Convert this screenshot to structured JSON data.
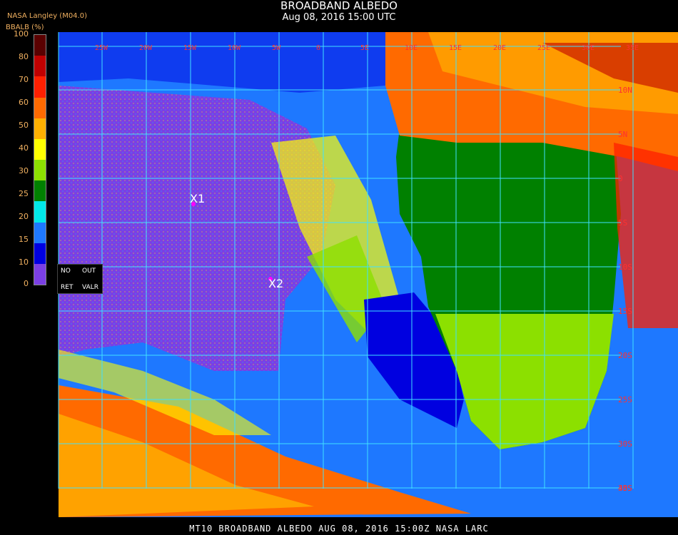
{
  "header": {
    "title": "BROADBAND ALBEDO",
    "subtitle": "Aug 08, 2016 15:00 UTC",
    "producer": "NASA Langley (M04.0)"
  },
  "legend": {
    "title": "BBALB (%)",
    "ticks": [
      "100",
      "80",
      "70",
      "60",
      "50",
      "40",
      "30",
      "25",
      "20",
      "15",
      "10",
      "0"
    ],
    "colors": [
      "#5a0000",
      "#c00000",
      "#ff2000",
      "#ff6a00",
      "#ffb000",
      "#ffff00",
      "#8ce000",
      "#008000",
      "#00e8e8",
      "#1e78ff",
      "#0000e0",
      "#7b3fe4"
    ],
    "no_data": {
      "no": "NO",
      "out": "OUT",
      "ret": "RET",
      "valr": "VALR"
    }
  },
  "markers": [
    {
      "id": "X1",
      "label": "X1"
    },
    {
      "id": "X2",
      "label": "X2"
    }
  ],
  "grid": {
    "lat_labels": [
      "15N",
      "10N",
      "5N",
      "0",
      "5S",
      "10S",
      "15S",
      "20S",
      "25S",
      "30S",
      "35S",
      "40S"
    ],
    "lon_labels": [
      "25W",
      "20W",
      "15W",
      "10W",
      "5W",
      "0",
      "5E",
      "10E",
      "15E",
      "20E",
      "25E",
      "30E",
      "35E"
    ]
  },
  "footer": "MT10  BROADBAND ALBEDO   AUG 08, 2016 15:00Z   NASA LARC"
}
